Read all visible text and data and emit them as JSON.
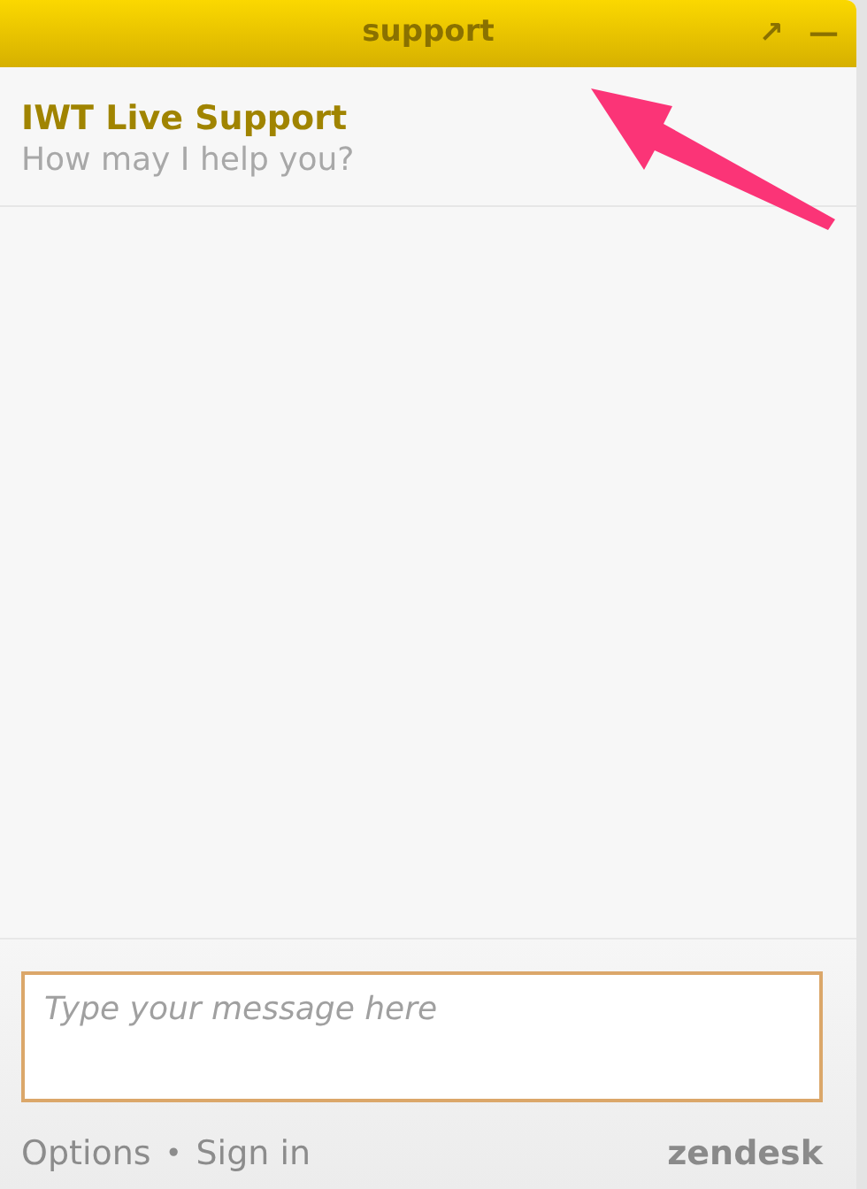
{
  "window": {
    "title": "support",
    "popout_glyph": "↗",
    "minimize_glyph": "—"
  },
  "agent": {
    "name": "IWT Live Support",
    "greeting": "How may I help you?"
  },
  "composer": {
    "placeholder": "Type your message here"
  },
  "footer": {
    "links": [
      "Options",
      "Sign in"
    ],
    "separator": "•",
    "brand": "zendesk"
  }
}
